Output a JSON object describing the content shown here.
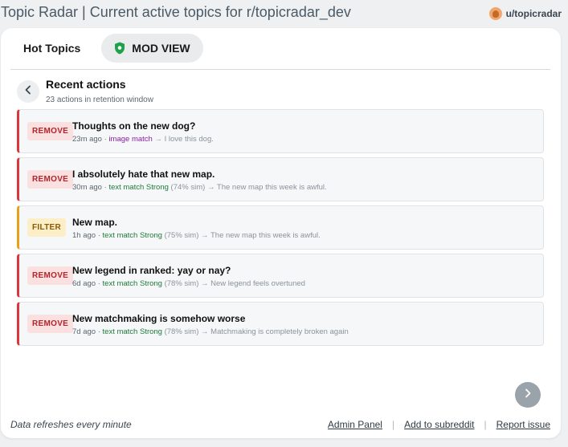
{
  "header": {
    "title": "Topic Radar | Current active topics for r/topicradar_dev",
    "username": "u/topicradar",
    "avatar_icon": "user-avatar-icon"
  },
  "tabs": [
    {
      "label": "Hot Topics",
      "active": false
    },
    {
      "label": "MOD VIEW",
      "active": true,
      "icon": "shield-check-icon",
      "icon_color": "#1aa34a"
    }
  ],
  "section": {
    "title": "Recent actions",
    "subtitle": "23 actions in retention window",
    "back_icon": "chevron-left-icon"
  },
  "actions": [
    {
      "badge": "REMOVE",
      "badge_type": "remove",
      "title": "Thoughts on the new dog?",
      "ago": "23m ago",
      "sep": "·",
      "match": "image match",
      "match_kind": "image",
      "strength": "",
      "sim": "",
      "arrow": "→",
      "target": "I love this dog."
    },
    {
      "badge": "REMOVE",
      "badge_type": "remove",
      "title": "I absolutely hate that new map.",
      "ago": "30m ago",
      "sep": "·",
      "match": "text match Strong",
      "match_kind": "text",
      "sim": "(74% sim)",
      "arrow": "→",
      "target": "The new map this week is awful."
    },
    {
      "badge": "FILTER",
      "badge_type": "filter",
      "title": "New map.",
      "ago": "1h ago",
      "sep": "·",
      "match": "text match Strong",
      "match_kind": "text",
      "sim": "(75% sim)",
      "arrow": "→",
      "target": "The new map this week is awful."
    },
    {
      "badge": "REMOVE",
      "badge_type": "remove",
      "title": "New legend in ranked: yay or nay?",
      "ago": "6d ago",
      "sep": "·",
      "match": "text match Strong",
      "match_kind": "text",
      "sim": "(78% sim)",
      "arrow": "→",
      "target": "New legend feels overtuned"
    },
    {
      "badge": "REMOVE",
      "badge_type": "remove",
      "title": "New matchmaking is somehow worse",
      "ago": "7d ago",
      "sep": "·",
      "match": "text match Strong",
      "match_kind": "text",
      "sim": "(78% sim)",
      "arrow": "→",
      "target": "Matchmaking is completely broken again"
    }
  ],
  "pager": {
    "next_icon": "chevron-right-icon"
  },
  "footer": {
    "note": "Data refreshes every minute",
    "links": [
      "Admin Panel",
      "Add to subreddit",
      "Report issue"
    ],
    "separator": "|"
  },
  "colors": {
    "remove_accent": "#d9363e",
    "filter_accent": "#e3a21a",
    "image_match": "#8a1fa8",
    "text_match": "#1e7a3a"
  }
}
